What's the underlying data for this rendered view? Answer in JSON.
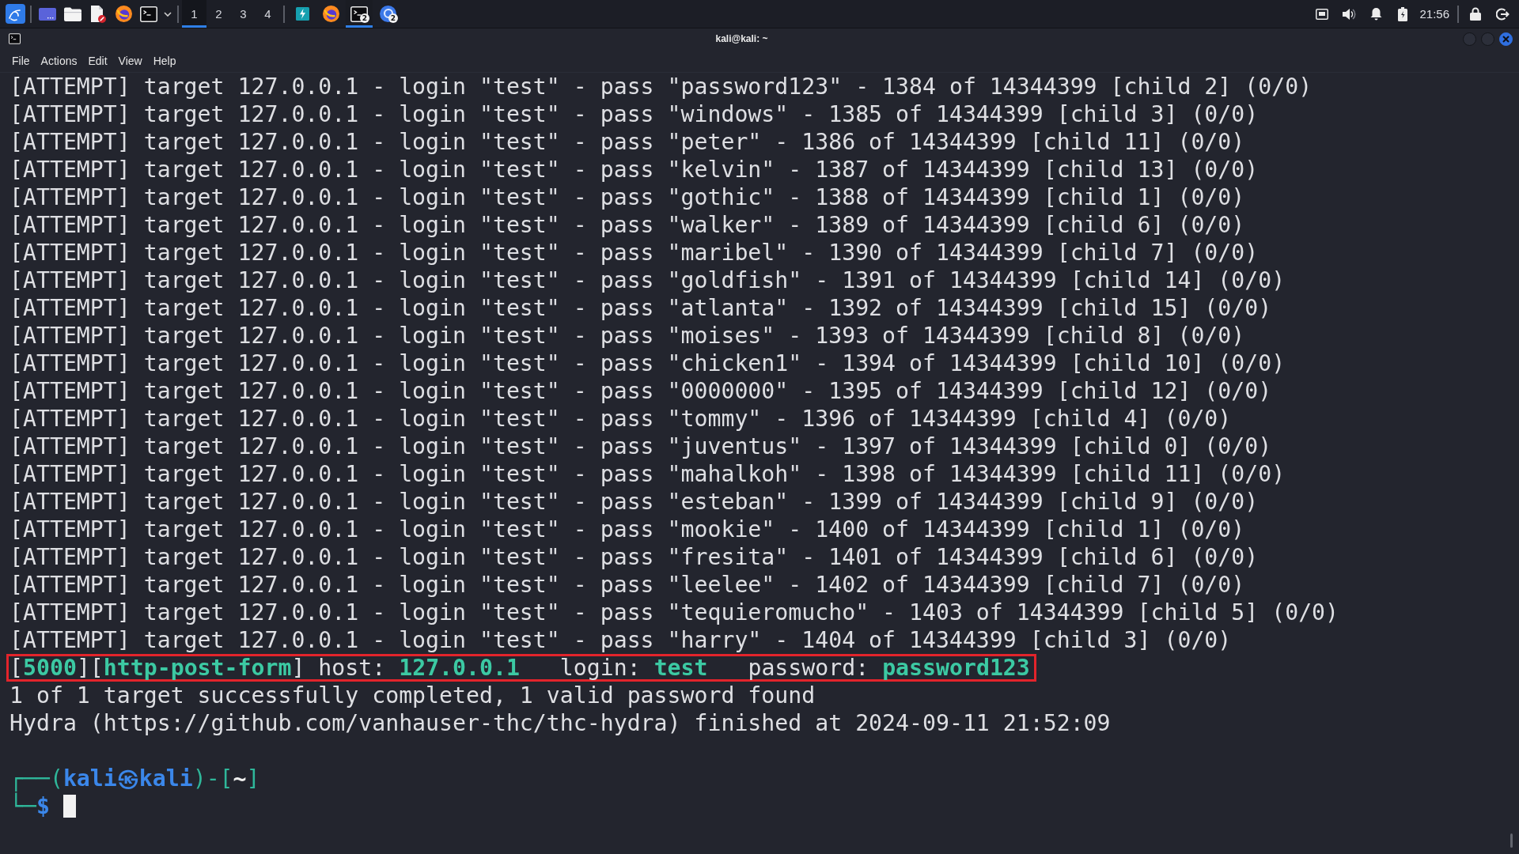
{
  "taskbar": {
    "workspaces": [
      {
        "label": "1",
        "selected": true
      },
      {
        "label": "2",
        "selected": false
      },
      {
        "label": "3",
        "selected": false
      },
      {
        "label": "4",
        "selected": false
      }
    ],
    "tasks": [
      {
        "kind": "bolt",
        "selected": false
      },
      {
        "kind": "browser",
        "selected": false
      },
      {
        "kind": "terminal",
        "badge": "2",
        "selected": true
      },
      {
        "kind": "ring",
        "badge": "2",
        "selected": false
      }
    ],
    "clock": "21:56"
  },
  "window": {
    "title": "kali@kali: ~",
    "menu": [
      "File",
      "Actions",
      "Edit",
      "View",
      "Help"
    ]
  },
  "terminal": {
    "output": [
      {
        "text": "[ATTEMPT] target 127.0.0.1 - login \"test\" - pass \"password123\" - 1384 of 14344399 [child 2] (0/0)",
        "boxed": false
      },
      {
        "text": "[ATTEMPT] target 127.0.0.1 - login \"test\" - pass \"windows\" - 1385 of 14344399 [child 3] (0/0)",
        "boxed": false
      },
      {
        "text": "[ATTEMPT] target 127.0.0.1 - login \"test\" - pass \"peter\" - 1386 of 14344399 [child 11] (0/0)",
        "boxed": false
      },
      {
        "text": "[ATTEMPT] target 127.0.0.1 - login \"test\" - pass \"kelvin\" - 1387 of 14344399 [child 13] (0/0)",
        "boxed": false
      },
      {
        "text": "[ATTEMPT] target 127.0.0.1 - login \"test\" - pass \"gothic\" - 1388 of 14344399 [child 1] (0/0)",
        "boxed": false
      },
      {
        "text": "[ATTEMPT] target 127.0.0.1 - login \"test\" - pass \"walker\" - 1389 of 14344399 [child 6] (0/0)",
        "boxed": false
      },
      {
        "text": "[ATTEMPT] target 127.0.0.1 - login \"test\" - pass \"maribel\" - 1390 of 14344399 [child 7] (0/0)",
        "boxed": false
      },
      {
        "text": "[ATTEMPT] target 127.0.0.1 - login \"test\" - pass \"goldfish\" - 1391 of 14344399 [child 14] (0/0)",
        "boxed": false
      },
      {
        "text": "[ATTEMPT] target 127.0.0.1 - login \"test\" - pass \"atlanta\" - 1392 of 14344399 [child 15] (0/0)",
        "boxed": false
      },
      {
        "text": "[ATTEMPT] target 127.0.0.1 - login \"test\" - pass \"moises\" - 1393 of 14344399 [child 8] (0/0)",
        "boxed": false
      },
      {
        "text": "[ATTEMPT] target 127.0.0.1 - login \"test\" - pass \"chicken1\" - 1394 of 14344399 [child 10] (0/0)",
        "boxed": false
      },
      {
        "text": "[ATTEMPT] target 127.0.0.1 - login \"test\" - pass \"0000000\" - 1395 of 14344399 [child 12] (0/0)",
        "boxed": false
      },
      {
        "text": "[ATTEMPT] target 127.0.0.1 - login \"test\" - pass \"tommy\" - 1396 of 14344399 [child 4] (0/0)",
        "boxed": false
      },
      {
        "text": "[ATTEMPT] target 127.0.0.1 - login \"test\" - pass \"juventus\" - 1397 of 14344399 [child 0] (0/0)",
        "boxed": false
      },
      {
        "text": "[ATTEMPT] target 127.0.0.1 - login \"test\" - pass \"mahalkoh\" - 1398 of 14344399 [child 11] (0/0)",
        "boxed": false
      },
      {
        "text": "[ATTEMPT] target 127.0.0.1 - login \"test\" - pass \"esteban\" - 1399 of 14344399 [child 9] (0/0)",
        "boxed": false
      },
      {
        "text": "[ATTEMPT] target 127.0.0.1 - login \"test\" - pass \"mookie\" - 1400 of 14344399 [child 1] (0/0)",
        "boxed": false
      },
      {
        "text": "[ATTEMPT] target 127.0.0.1 - login \"test\" - pass \"fresita\" - 1401 of 14344399 [child 6] (0/0)",
        "boxed": false
      },
      {
        "text": "[ATTEMPT] target 127.0.0.1 - login \"test\" - pass \"leelee\" - 1402 of 14344399 [child 7] (0/0)",
        "boxed": false
      },
      {
        "text": "[ATTEMPT] target 127.0.0.1 - login \"test\" - pass \"tequieromucho\" - 1403 of 14344399 [child 5] (0/0)",
        "boxed": false
      },
      {
        "text": "[ATTEMPT] target 127.0.0.1 - login \"test\" - pass \"harry\" - 1404 of 14344399 [child 3] (0/0)",
        "boxed": false
      },
      {
        "segments": [
          {
            "text": "[",
            "kind": "plain"
          },
          {
            "text": "5000",
            "kind": "found"
          },
          {
            "text": "][",
            "kind": "plain"
          },
          {
            "text": "http-post-form",
            "kind": "found"
          },
          {
            "text": "] host: ",
            "kind": "plain"
          },
          {
            "text": "127.0.0.1",
            "kind": "found"
          },
          {
            "text": "   login: ",
            "kind": "plain"
          },
          {
            "text": "test",
            "kind": "found"
          },
          {
            "text": "   password: ",
            "kind": "plain"
          },
          {
            "text": "password123",
            "kind": "found"
          }
        ],
        "boxed": true
      },
      {
        "text": "1 of 1 target successfully completed, 1 valid password found",
        "boxed": false
      },
      {
        "text": "Hydra (https://github.com/vanhauser-thc/thc-hydra) finished at 2024-09-11 21:52:09",
        "boxed": false
      }
    ],
    "prompt": [
      {
        "segments": [
          {
            "text": "┌──(",
            "kind": "frame"
          },
          {
            "text": "kali㉿kali",
            "kind": "user"
          },
          {
            "text": ")-[",
            "kind": "frame"
          },
          {
            "text": "~",
            "kind": "path"
          },
          {
            "text": "]",
            "kind": "frame"
          }
        ]
      },
      {
        "segments": [
          {
            "text": "└─",
            "kind": "frame"
          },
          {
            "text": "$",
            "kind": "user"
          }
        ]
      }
    ],
    "cursor": true
  }
}
